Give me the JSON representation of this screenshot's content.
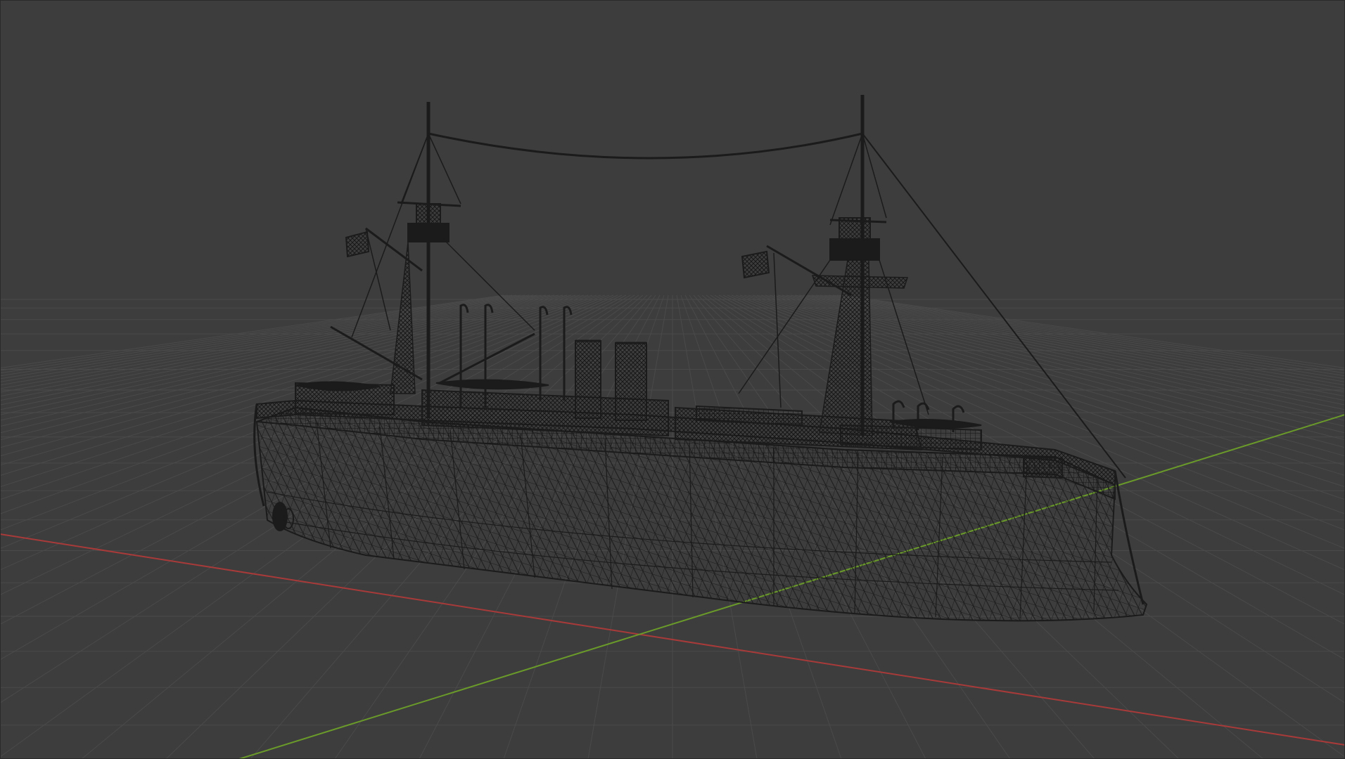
{
  "viewport": {
    "mode": "wireframe",
    "object": "ship-model",
    "colors": {
      "background": "#3d3d3d",
      "grid_line": "#4a4a4a",
      "x_axis": "#a83a3a",
      "y_axis": "#6a9a2a",
      "wire": "#1b1b1b",
      "wire_dense": "#141414"
    },
    "icons": [
      "flag-icon",
      "flag-icon"
    ]
  }
}
